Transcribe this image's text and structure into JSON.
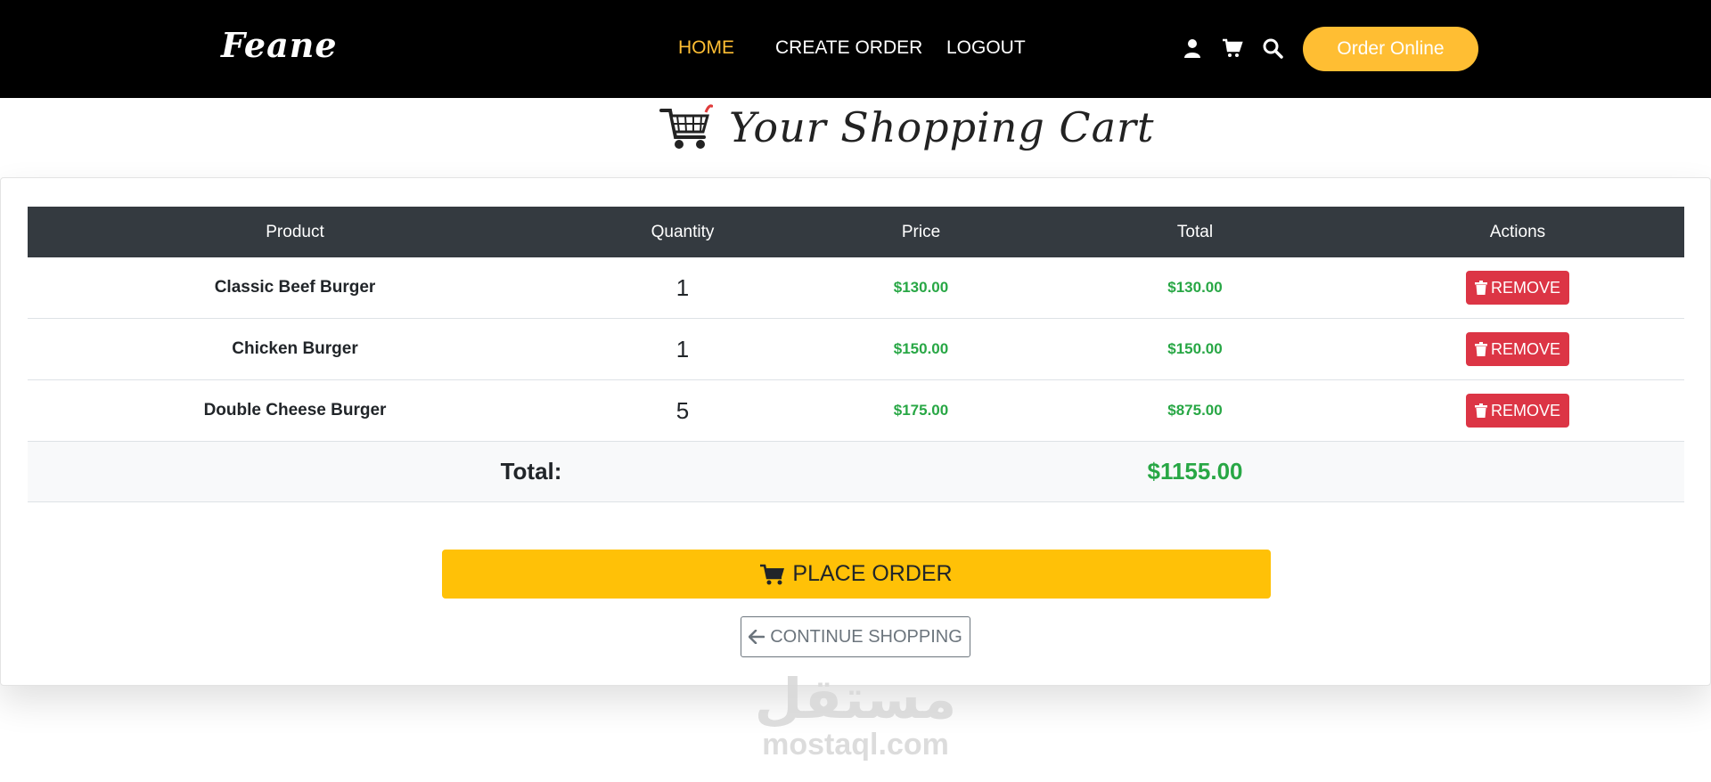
{
  "navbar": {
    "brand": "Feane",
    "links": [
      "HOME",
      "CREATE ORDER",
      "LOGOUT"
    ],
    "active_link": "HOME",
    "icons": [
      "user-icon",
      "cart-icon",
      "search-icon"
    ],
    "cta_label": "Order Online"
  },
  "heading": {
    "title": "Your Shopping Cart",
    "icon": "shopping-cart-icon"
  },
  "cart": {
    "columns": [
      "Product",
      "Quantity",
      "Price",
      "Total",
      "Actions"
    ],
    "items": [
      {
        "product": "Classic Beef Burger",
        "quantity": "1",
        "price": "$130.00",
        "total": "$130.00",
        "action": "REMOVE"
      },
      {
        "product": "Chicken Burger",
        "quantity": "1",
        "price": "$150.00",
        "total": "$150.00",
        "action": "REMOVE"
      },
      {
        "product": "Double Cheese Burger",
        "quantity": "5",
        "price": "$175.00",
        "total": "$875.00",
        "action": "REMOVE"
      }
    ],
    "total_label": "Total:",
    "total_value": "$1155.00"
  },
  "actions": {
    "place_order": "PLACE ORDER",
    "continue_shopping": "CONTINUE SHOPPING"
  },
  "watermark": {
    "arabic": "مستقل",
    "latin": "mostaql.com"
  },
  "colors": {
    "accent": "#ffbe33",
    "money": "#28a745",
    "danger": "#dc3545",
    "warning": "#ffc107",
    "header": "#343a40"
  }
}
